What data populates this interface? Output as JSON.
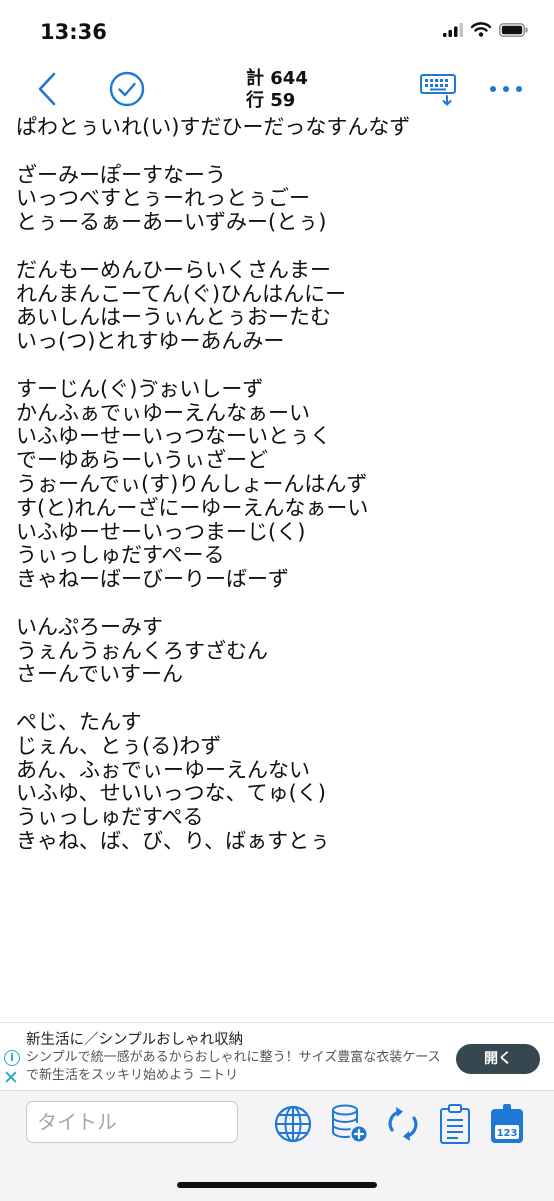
{
  "status_bar": {
    "time": "13:36",
    "icons": [
      "cellular-signal-icon",
      "wifi-icon",
      "battery-icon"
    ]
  },
  "nav": {
    "back_icon": "chevron-left-icon",
    "done_icon": "checkmark-circle-icon",
    "count_total": "計 644",
    "count_lines": "行 59",
    "keyboard_icon": "keyboard-dismiss-icon",
    "more_icon": "ellipsis-icon"
  },
  "lines": [
    "ぱわとぅいれ(い)すだひーだっなすんなず",
    "",
    "ざーみーぽーすなーう",
    "いっつべすとぅーれっとぅごー",
    "とぅーるぁーあーいずみー(とぅ)",
    "",
    "だんもーめんひーらいくさんまー",
    "れんまんこーてん(ぐ)ひんはんにー",
    "あいしんはーうぃんとぅおーたむ",
    "いっ(つ)とれすゆーあんみー",
    "",
    "すーじん(ぐ)ゔぉいしーず",
    "かんふぁでぃゆーえんなぁーい",
    "いふゆーせーいっつなーいとぅく",
    "でーゆあらーいうぃざーど",
    "うぉーんでぃ(す)りんしょーんはんず",
    "す(と)れんーざにーゆーえんなぁーい",
    "いふゆーせーいっつまーじ(く)",
    "うぃっしゅだすぺーる",
    "きゃねーばーびーりーばーず",
    "",
    "いんぷろーみす",
    "うぇんうぉんくろすざむん",
    "さーんでいすーん",
    "",
    "ぺじ、たんす",
    "じぇん、とぅ(る)わず",
    "あん、ふぉでぃーゆーえんない",
    "いふゆ、せいいっつな、てゅ(く)",
    "うぃっしゅだすぺる",
    "きゃね、ば、び、り、ばぁすとぅ"
  ],
  "ad": {
    "title": "新生活に／シンプルおしゃれ収納",
    "body": "シンプルで統一感があるからおしゃれに整う！サイズ豊富な衣装ケースで新生活をスッキリ始めよう ニトリ",
    "button_label": "開く",
    "info_icon": "info-icon",
    "close_icon": "close-icon"
  },
  "toolbar": {
    "title_placeholder": "タイトル",
    "buttons": [
      "globe-icon",
      "database-add-icon",
      "sync-icon",
      "clipboard-icon",
      "counter-icon"
    ],
    "counter_value": "123"
  },
  "colors": {
    "accent": "#1e78d6",
    "ad_accent": "#2aa6c9",
    "ad_button": "#37474f"
  }
}
